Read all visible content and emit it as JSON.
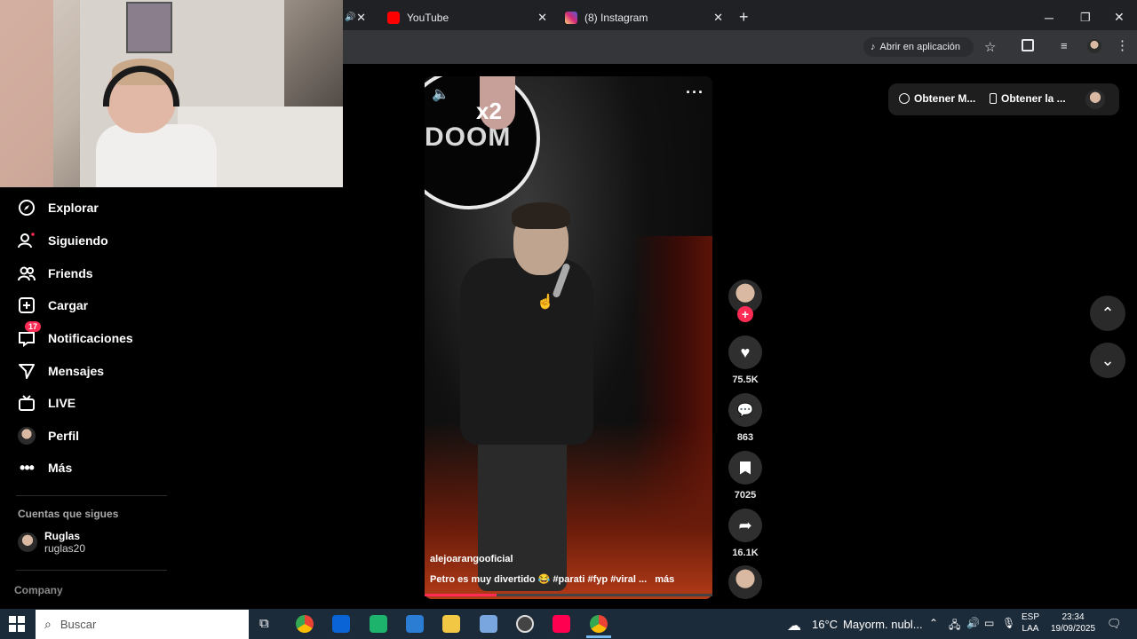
{
  "browser": {
    "tabs": [
      {
        "label": "YouTube",
        "favicon_color": "#ff0000"
      },
      {
        "label": "(8) Instagram",
        "favicon_color": "#d62976"
      }
    ],
    "open_in_app": "Abrir en aplicación"
  },
  "header": {
    "get_app_btn": "Obtener M...",
    "get_desktop_btn": "Obtener la ..."
  },
  "sidebar": {
    "items": [
      {
        "label": "Explorar",
        "icon": "compass-icon"
      },
      {
        "label": "Siguiendo",
        "icon": "user-follow-icon"
      },
      {
        "label": "Friends",
        "icon": "friends-icon"
      },
      {
        "label": "Cargar",
        "icon": "upload-icon"
      },
      {
        "label": "Notificaciones",
        "icon": "inbox-icon",
        "badge": "17"
      },
      {
        "label": "Mensajes",
        "icon": "send-icon"
      },
      {
        "label": "LIVE",
        "icon": "live-icon"
      },
      {
        "label": "Perfil",
        "icon": "profile-avatar"
      },
      {
        "label": "Más",
        "icon": "more-icon"
      }
    ],
    "following_title": "Cuentas que sigues",
    "following": [
      {
        "name": "Ruglas",
        "handle": "ruglas20"
      }
    ],
    "company_label": "Company"
  },
  "video": {
    "author": "alejoarangooficial",
    "caption": "Petro es muy divertido 😂 #parati #fyp #viral ...",
    "more_label": "más",
    "progress_fraction": 0.25,
    "overlay_text": "x2",
    "stage_logo": "DOOM"
  },
  "actions": {
    "likes": "75.5K",
    "comments": "863",
    "saves": "7025",
    "shares": "16.1K"
  },
  "taskbar": {
    "search_placeholder": "Buscar",
    "weather": "16°C",
    "weather_desc": "Mayorm. nubl...",
    "lang": "ESP",
    "layout": "LAA",
    "time": "23:34",
    "date": "19/09/2025"
  }
}
